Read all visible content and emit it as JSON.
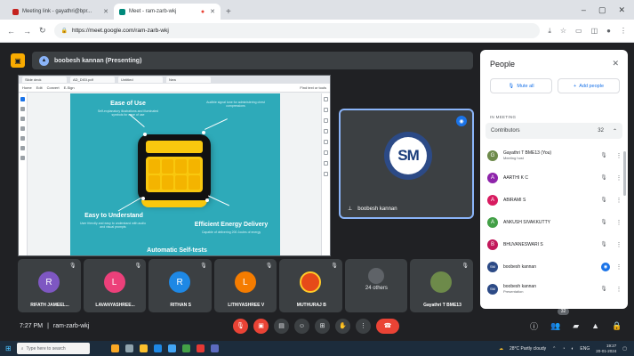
{
  "browser": {
    "tabs": [
      {
        "title": "Meeting link - gayathri@bpr...",
        "active": false,
        "color": "#c5221f"
      },
      {
        "title": "Meet - ram-zarb-wkj",
        "active": true,
        "color": "#00897b"
      }
    ],
    "new_tab": "+",
    "window_controls": [
      "–",
      "▢",
      "✕"
    ],
    "url": "https://meet.google.com/ram-zarb-wkj"
  },
  "meet": {
    "presenting_label": "boobesh kannan (Presenting)",
    "presenter": {
      "initials": "SM",
      "name": "boobesh kannan"
    },
    "slide": {
      "tabs": [
        "Slide deck",
        "AD_DIGI.pdf",
        "Untitled",
        "New"
      ],
      "menu": [
        "Home",
        "Edit",
        "Convert",
        "E-Sign"
      ],
      "menu_right": "Find text or tools",
      "features": [
        {
          "title": "Ease of Use",
          "sub": "Self-explanatory illustrations and illuminated symbols for ease of use"
        },
        {
          "title": "Easy to Understand",
          "sub": "User friendly and easy to understand with audio and visual prompts"
        },
        {
          "title": "Efficient Energy Delivery",
          "sub": "Capable of delivering 200 Joules of energy"
        },
        {
          "title": "Automatic Self-tests",
          "sub": ""
        }
      ],
      "top_right_note": "Audible signal tone for administering chest compressions"
    },
    "participants": [
      {
        "initial": "R",
        "name": "RIFATH JAMEEL...",
        "color": "#7e57c2"
      },
      {
        "initial": "L",
        "name": "LAVANYASHREE...",
        "color": "#ec407a"
      },
      {
        "initial": "R",
        "name": "RITHAN S",
        "color": "#1e88e5"
      },
      {
        "initial": "L",
        "name": "LITHIYASHREE V",
        "color": "#f57c00"
      },
      {
        "initial": "",
        "name": "MUTHURAJ B",
        "color": "#e64a19"
      },
      {
        "initial": "",
        "name": "",
        "others": "24 others",
        "color": "#5f6368"
      },
      {
        "initial": "",
        "name": "Gayathri T BME13",
        "color": "#6d8a4a"
      }
    ],
    "time": "7:27 PM",
    "separator": "|",
    "meeting_code": "ram-zarb-wkj",
    "control_icons": [
      "mic-off",
      "cam-off",
      "captions",
      "emoji",
      "present",
      "raise-hand",
      "more",
      "end-call"
    ],
    "people_count_badge": "32"
  },
  "people_panel": {
    "title": "People",
    "mute_all": "Mute all",
    "add_people": "Add people",
    "section": "IN MEETING",
    "contributors_label": "Contributors",
    "contributors_count": "32",
    "list": [
      {
        "initial": "G",
        "name": "Gayathri T BME13 (You)",
        "sub": "Meeting host",
        "color": "#6d8a4a",
        "mic": "off"
      },
      {
        "initial": "A",
        "name": "AARTHI K C",
        "sub": "",
        "color": "#8e24aa",
        "mic": "off"
      },
      {
        "initial": "A",
        "name": "ABIRAMI S",
        "sub": "",
        "color": "#d81b60",
        "mic": "off"
      },
      {
        "initial": "A",
        "name": "ANKUSH SIVAKKUTTY",
        "sub": "",
        "color": "#43a047",
        "mic": "off"
      },
      {
        "initial": "B",
        "name": "BHUVANESWARI S",
        "sub": "",
        "color": "#c2185b",
        "mic": "off"
      },
      {
        "initial": "SM",
        "name": "boobesh kannan",
        "sub": "",
        "color": "#2c4a86",
        "mic": "on"
      },
      {
        "initial": "SM",
        "name": "boobesh kannan",
        "sub": "Presentation",
        "color": "#2c4a86",
        "mic": "off"
      }
    ]
  },
  "taskbar": {
    "search_placeholder": "Type here to search",
    "weather": "28°C Partly cloudy",
    "lang": "ENG",
    "time": "19:27",
    "date": "20-01-2024"
  }
}
